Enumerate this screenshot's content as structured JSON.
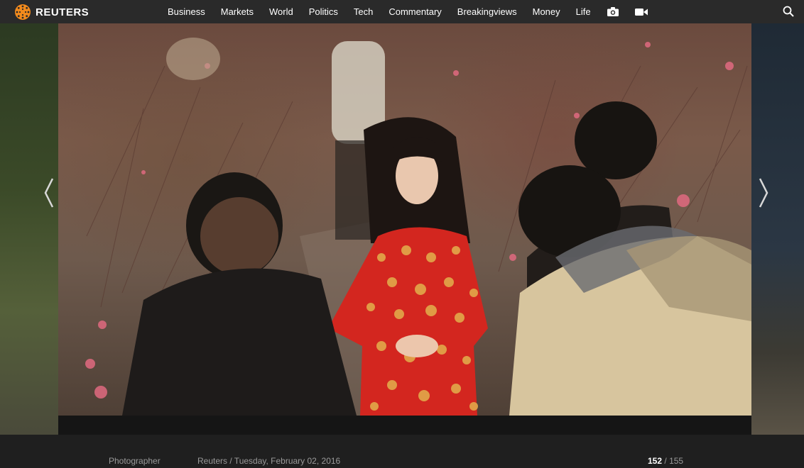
{
  "header": {
    "brand": "REUTERS",
    "nav": [
      "Business",
      "Markets",
      "World",
      "Politics",
      "Tech",
      "Commentary",
      "Breakingviews",
      "Money",
      "Life"
    ],
    "icons": [
      "camera-icon",
      "video-icon",
      "search-icon"
    ]
  },
  "gallery": {
    "prev_icon": "chevron-left-icon",
    "next_icon": "chevron-right-icon",
    "photographer_label": "Photographer",
    "credit": "Reuters / Tuesday, February 02, 2016",
    "current": "152",
    "separator": "/",
    "total": "155"
  },
  "colors": {
    "topbar": "#2a2a2a",
    "brand_orange": "#f28a1c",
    "caption_text": "#9a9a9a"
  }
}
